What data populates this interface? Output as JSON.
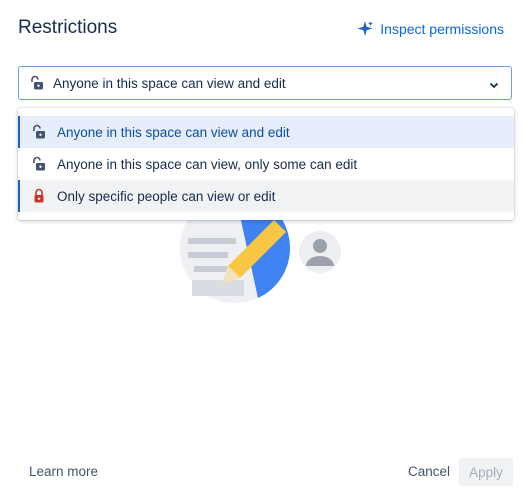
{
  "dialog": {
    "title": "Restrictions",
    "inspect_label": "Inspect permissions",
    "select": {
      "value": "Anyone in this space can view and edit",
      "icon": "unlocked-icon"
    },
    "options": [
      {
        "label": "Anyone in this space can view and edit",
        "icon": "unlocked-icon",
        "state": "selected"
      },
      {
        "label": "Anyone in this space can view, only some can edit",
        "icon": "unlocked-icon",
        "state": "normal"
      },
      {
        "label": "Only specific people can view or edit",
        "icon": "locked-icon",
        "state": "hover"
      }
    ],
    "footer": {
      "learn_more": "Learn more",
      "cancel": "Cancel",
      "apply": "Apply"
    }
  },
  "colors": {
    "accent": "#0c66e4",
    "selected_bg": "#e6eefc",
    "lock_red": "#c9372c",
    "text": "#172b4d"
  }
}
